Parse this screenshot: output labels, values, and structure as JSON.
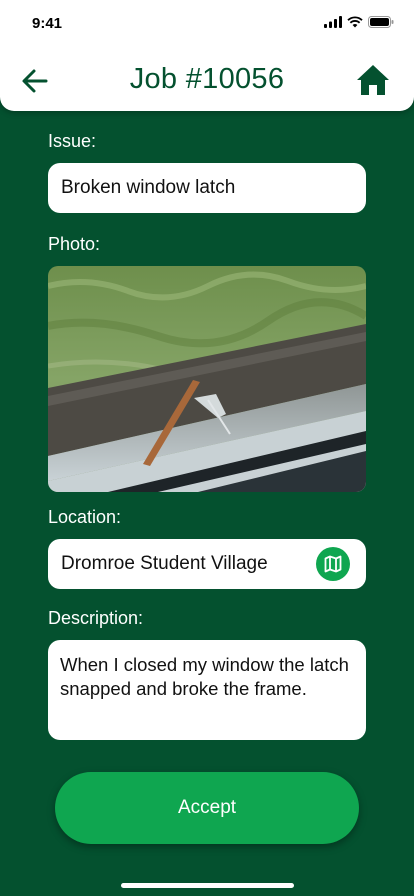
{
  "status_bar": {
    "time": "9:41"
  },
  "header": {
    "title": "Job #10056"
  },
  "issue": {
    "label": "Issue:",
    "value": "Broken window latch"
  },
  "photo": {
    "label": "Photo:"
  },
  "location": {
    "label": "Location:",
    "value": "Dromroe Student Village"
  },
  "description": {
    "label": "Description:",
    "value": "When I closed my window the latch snapped and broke the frame."
  },
  "actions": {
    "accept_label": "Accept"
  },
  "colors": {
    "primary_dark": "#04512F",
    "accent": "#0FA650",
    "surface": "#FFFFFF"
  }
}
